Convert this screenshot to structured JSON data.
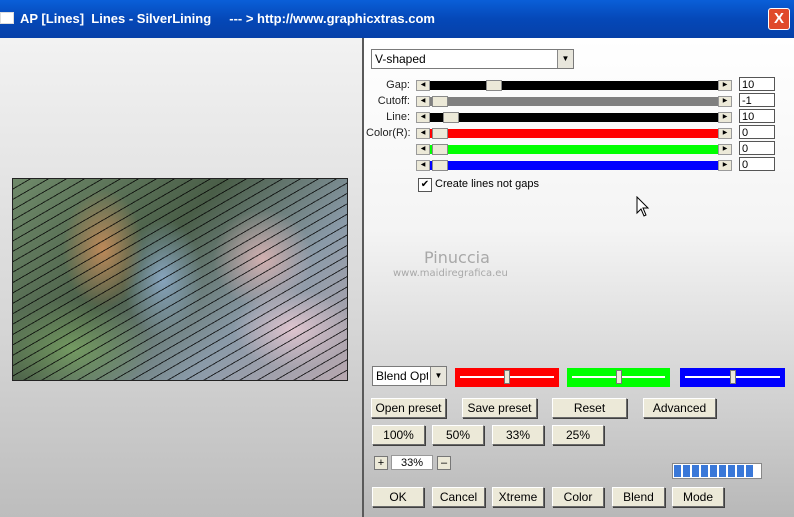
{
  "window": {
    "title": "AP [Lines]  Lines - SilverLining     --- > http://www.graphicxtras.com",
    "close_label": "X"
  },
  "style_select": {
    "value": "V-shaped"
  },
  "params": [
    {
      "label": "Gap:",
      "value": "10",
      "color": "#000000",
      "thumb": 0.2
    },
    {
      "label": "Cutoff:",
      "value": "-1",
      "color": "#808080",
      "thumb": 0.0
    },
    {
      "label": "Line:",
      "value": "10",
      "color": "#000000",
      "thumb": 0.04
    },
    {
      "label": "Color(R):",
      "value": "0",
      "color": "#ff0000",
      "thumb": 0.0
    },
    {
      "label": "",
      "value": "0",
      "color": "#00ff00",
      "thumb": 0.0
    },
    {
      "label": "",
      "value": "0",
      "color": "#0000ff",
      "thumb": 0.0
    }
  ],
  "checkbox": {
    "label": "Create lines not gaps",
    "checked": true,
    "mark": "✔"
  },
  "watermark": {
    "name": "Pinuccia",
    "url": "www.maidiregrafica.eu"
  },
  "blend_select": {
    "value": "Blend Options"
  },
  "blend_sliders": [
    {
      "color": "#ff0000",
      "level": 0.5
    },
    {
      "color": "#00ff00",
      "level": 0.5
    },
    {
      "color": "#0000ff",
      "level": 0.5
    }
  ],
  "buttons_row1": [
    "Open preset",
    "Save preset",
    "Reset",
    "Advanced"
  ],
  "zoom_buttons": [
    "100%",
    "50%",
    "33%",
    "25%"
  ],
  "zoom": {
    "plus": "+",
    "value": "33%",
    "minus": "–"
  },
  "progress": {
    "filled": 9
  },
  "bottom_buttons": [
    "OK",
    "Cancel",
    "Xtreme",
    "Color",
    "Blend",
    "Mode"
  ]
}
